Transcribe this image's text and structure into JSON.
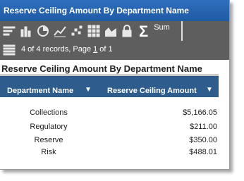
{
  "window": {
    "title": "Reserve Ceiling Amount By Department Name"
  },
  "toolbar": {
    "icons": [
      "filter-icon",
      "bar-chart-icon",
      "pie-chart-icon",
      "line-chart-icon",
      "scatter-icon",
      "grid-icon",
      "area-chart-icon",
      "lock-icon"
    ],
    "sum_label": "Sum",
    "sigma": "Σ"
  },
  "pager": {
    "prefix": "4 of 4 records, Page ",
    "page": "1",
    "suffix": " of 1"
  },
  "report": {
    "title": "Reserve Ceiling Amount By Department Name",
    "columns": [
      "Department Name",
      "Reserve Ceiling Amount"
    ],
    "sort_glyph": "▼",
    "rows": [
      {
        "dept": "Collections",
        "amount": "$5,166.05"
      },
      {
        "dept": "Regulatory",
        "amount": "$211.00"
      },
      {
        "dept": "Reserve",
        "amount": "$350.00"
      },
      {
        "dept": "Risk",
        "amount": "$488.01"
      }
    ]
  },
  "colors": {
    "titlebar": "#1f5aa4",
    "toolbar": "#5e5e5e",
    "header": "#2d5c8d"
  }
}
